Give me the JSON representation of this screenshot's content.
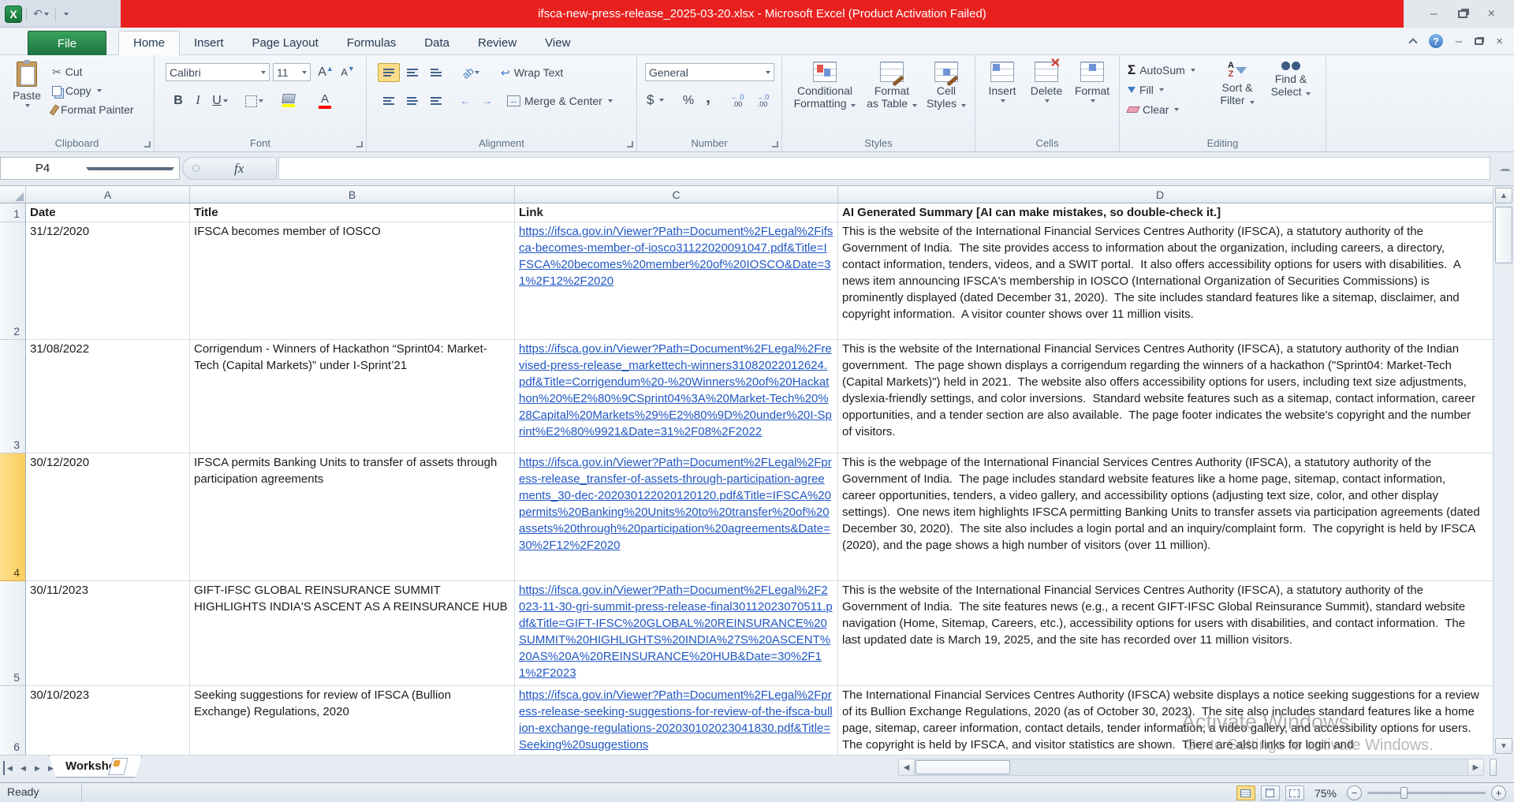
{
  "title_bar": {
    "title": "ifsca-new-press-release_2025-03-20.xlsx -  Microsoft Excel (Product Activation Failed)"
  },
  "tabs": [
    "File",
    "Home",
    "Insert",
    "Page Layout",
    "Formulas",
    "Data",
    "Review",
    "View"
  ],
  "ribbon": {
    "clipboard": {
      "label": "Clipboard",
      "paste": "Paste",
      "cut": "Cut",
      "copy": "Copy",
      "format_painter": "Format Painter"
    },
    "font": {
      "label": "Font",
      "family": "Calibri",
      "size": "11",
      "bold": "B",
      "italic": "I",
      "underline": "U"
    },
    "alignment": {
      "label": "Alignment",
      "wrap_text": "Wrap Text",
      "merge_center": "Merge & Center",
      "orientation": "ab"
    },
    "number": {
      "label": "Number",
      "format": "General",
      "currency": "$",
      "percent": "%",
      "comma": ",",
      "inc_top": "←.0",
      "inc_bot": ".00",
      "dec_top": "→.0",
      "dec_bot": ".00"
    },
    "styles": {
      "label": "Styles",
      "conditional_1": "Conditional",
      "conditional_2": "Formatting",
      "table_1": "Format",
      "table_2": "as Table",
      "cell_1": "Cell",
      "cell_2": "Styles"
    },
    "cells": {
      "label": "Cells",
      "insert": "Insert",
      "delete": "Delete",
      "format": "Format"
    },
    "editing": {
      "label": "Editing",
      "sigma": "Σ",
      "autosum": "AutoSum",
      "fill": "Fill",
      "clear": "Clear",
      "sort_1": "Sort &",
      "sort_2": "Filter",
      "find_1": "Find &",
      "find_2": "Select",
      "a": "A",
      "z": "Z"
    }
  },
  "formula_bar": {
    "name_box": "P4",
    "fx": "fx",
    "value": ""
  },
  "grid": {
    "columns": [
      "A",
      "B",
      "C",
      "D"
    ],
    "header_row": {
      "num": "1",
      "date": "Date",
      "title": "Title",
      "link": "Link",
      "summary": "AI Generated Summary [AI can make mistakes, so double-check it.]"
    },
    "rows": [
      {
        "num": "2",
        "date": "31/12/2020",
        "title": "IFSCA becomes member of IOSCO",
        "link": "https://ifsca.gov.in/Viewer?Path=Document%2FLegal%2Fifsca-becomes-member-of-iosco31122020091047.pdf&Title=IFSCA%20becomes%20member%20of%20IOSCO&Date=31%2F12%2F2020",
        "summary": "This is the website of the International Financial Services Centres Authority (IFSCA), a statutory authority of the Government of India.  The site provides access to information about the organization, including careers, a directory, contact information, tenders, videos, and a SWIT portal.  It also offers accessibility options for users with disabilities.  A news item announcing IFSCA's membership in IOSCO (International Organization of Securities Commissions) is prominently displayed (dated December 31, 2020).  The site includes standard features like a sitemap, disclaimer, and copyright information.  A visitor counter shows over 11 million visits."
      },
      {
        "num": "3",
        "date": "31/08/2022",
        "title": "Corrigendum - Winners of Hackathon “Sprint04: Market-Tech (Capital Markets)” under I-Sprint’21",
        "link": "https://ifsca.gov.in/Viewer?Path=Document%2FLegal%2Frevised-press-release_markettech-winners31082022012624.pdf&Title=Corrigendum%20-%20Winners%20of%20Hackathon%20%E2%80%9CSprint04%3A%20Market-Tech%20%28Capital%20Markets%29%E2%80%9D%20under%20I-Sprint%E2%80%9921&Date=31%2F08%2F2022",
        "summary": "This is the website of the International Financial Services Centres Authority (IFSCA), a statutory authority of the Indian government.  The page shown displays a corrigendum regarding the winners of a hackathon (\"Sprint04: Market-Tech (Capital Markets)\") held in 2021.  The website also offers accessibility options for users, including text size adjustments, dyslexia-friendly settings, and color inversions.  Standard website features such as a sitemap, contact information, career opportunities, and a tender section are also available.  The page footer indicates the website's copyright and the number of visitors."
      },
      {
        "num": "4",
        "date": "30/12/2020",
        "title": "IFSCA permits Banking Units to transfer of assets through participation agreements",
        "link": "https://ifsca.gov.in/Viewer?Path=Document%2FLegal%2Fpress-release_transfer-of-assets-through-participation-agreements_30-dec-202030122020120120.pdf&Title=IFSCA%20permits%20Banking%20Units%20to%20transfer%20of%20assets%20through%20participation%20agreements&Date=30%2F12%2F2020",
        "summary": "This is the webpage of the International Financial Services Centres Authority (IFSCA), a statutory authority of the Government of India.  The page includes standard website features like a home page, sitemap, contact information, career opportunities, tenders, a video gallery, and accessibility options (adjusting text size, color, and other display settings).  One news item highlights IFSCA permitting Banking Units to transfer assets via participation agreements (dated December 30, 2020).  The site also includes a login portal and an inquiry/complaint form.  The copyright is held by IFSCA (2020), and the page shows a high number of visitors (over 11 million)."
      },
      {
        "num": "5",
        "date": "30/11/2023",
        "title": "GIFT-IFSC GLOBAL REINSURANCE SUMMIT HIGHLIGHTS INDIA'S ASCENT AS A REINSURANCE HUB",
        "link": "https://ifsca.gov.in/Viewer?Path=Document%2FLegal%2F2023-11-30-gri-summit-press-release-final30112023070511.pdf&Title=GIFT-IFSC%20GLOBAL%20REINSURANCE%20SUMMIT%20HIGHLIGHTS%20INDIA%27S%20ASCENT%20AS%20A%20REINSURANCE%20HUB&Date=30%2F11%2F2023",
        "summary": "This is the website of the International Financial Services Centres Authority (IFSCA), a statutory authority of the Government of India.  The site features news (e.g., a recent GIFT-IFSC Global Reinsurance Summit), standard website navigation (Home, Sitemap, Careers, etc.), accessibility options for users with disabilities, and contact information.  The last updated date is March 19, 2025, and the site has recorded over 11 million visitors."
      },
      {
        "num": "6",
        "date": "30/10/2023",
        "title": "Seeking suggestions for review of IFSCA (Bullion Exchange) Regulations, 2020",
        "link": "https://ifsca.gov.in/Viewer?Path=Document%2FLegal%2Fpress-release-seeking-suggestions-for-review-of-the-ifsca-bullion-exchange-regulations-202030102023041830.pdf&Title=Seeking%20suggestions",
        "summary": "The International Financial Services Centres Authority (IFSCA) website displays a notice seeking suggestions for a review of its Bullion Exchange Regulations, 2020 (as of October 30, 2023).  The site also includes standard features like a home page, sitemap, career information, contact details, tender information, a video gallery, and accessibility options for users.  The copyright is held by IFSCA, and visitor statistics are shown.  There are also links for login and"
      }
    ]
  },
  "sheet_bar": {
    "tab": "Worksheet"
  },
  "status_bar": {
    "mode": "Ready",
    "zoom": "75%"
  },
  "watermark": {
    "line1": "Activate Windows",
    "line2": "Go to Settings to activate Windows."
  },
  "icons": {
    "excel_logo": "X",
    "undo": "↶",
    "scissors": "✂",
    "help": "?",
    "minimize": "–",
    "close": "×",
    "prev": "◀",
    "next": "▶",
    "up": "▲",
    "down": "▼",
    "wrap_return": "↩",
    "merge_arrows": "↔",
    "indent_out": "←",
    "indent_in": "→",
    "grow": "A",
    "shrink": "A",
    "font_color": "A"
  }
}
